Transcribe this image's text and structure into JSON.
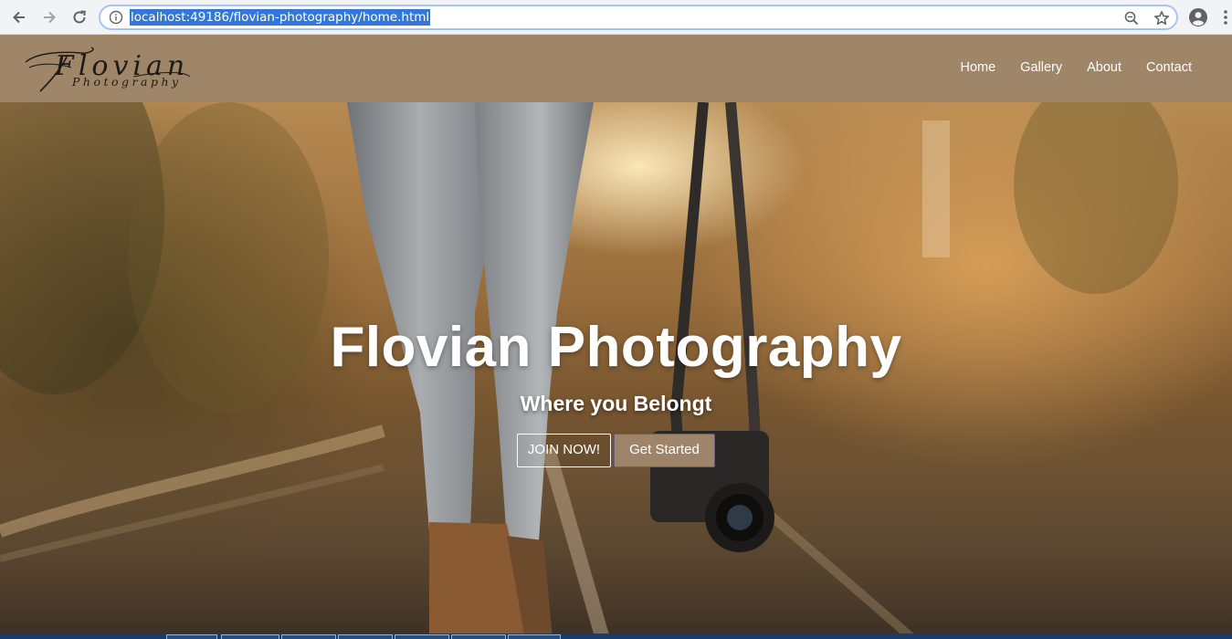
{
  "browser": {
    "url": "localhost:49186/flovian-photography/home.html",
    "icons": [
      "back-arrow-icon",
      "forward-arrow-icon",
      "reload-icon",
      "info-icon",
      "zoom-icon",
      "star-icon",
      "profile-icon",
      "kebab-menu-icon"
    ]
  },
  "site": {
    "logo": {
      "script": "Flovian",
      "subtitle": "Photography"
    },
    "nav": [
      {
        "label": "Home"
      },
      {
        "label": "Gallery"
      },
      {
        "label": "About"
      },
      {
        "label": "Contact"
      }
    ],
    "colors": {
      "navbar": "#a08669",
      "button_fill": "#9e8468"
    }
  },
  "hero": {
    "title": "Flovian Photography",
    "subtitle": "Where you Belongt",
    "buttons": {
      "join": "JOIN NOW!",
      "start": "Get Started"
    }
  }
}
